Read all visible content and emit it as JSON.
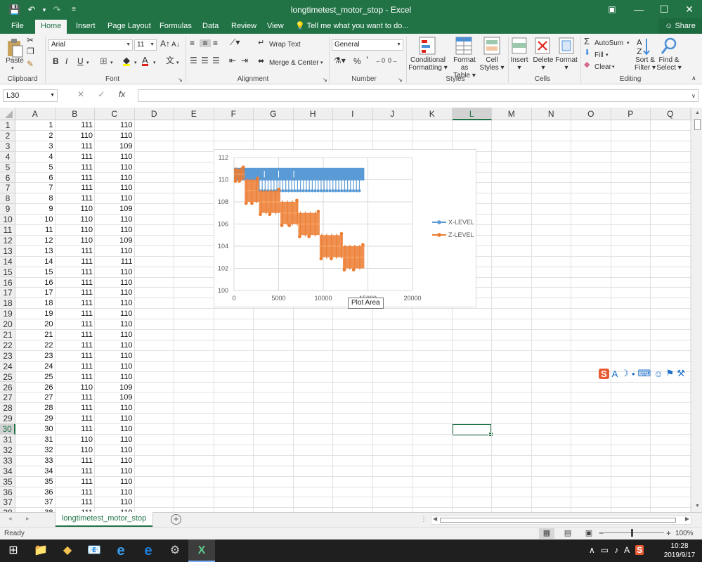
{
  "window": {
    "title": "longtimetest_motor_stop - Excel",
    "minimize": "—",
    "maximize": "☐",
    "close": "✕",
    "ribbon_options": "▣"
  },
  "qat": {
    "save": "💾",
    "undo": "↶",
    "undo_dd": "▾",
    "redo": "↷",
    "customize": "≡"
  },
  "tabs": [
    "File",
    "Home",
    "Insert",
    "Page Layout",
    "Formulas",
    "Data",
    "Review",
    "View"
  ],
  "active_tab": "Home",
  "tell_me": "Tell me what you want to do...",
  "share": "Share",
  "ribbon": {
    "clipboard": {
      "label": "Clipboard",
      "paste": "Paste"
    },
    "font": {
      "label": "Font",
      "name": "Arial",
      "size": "11",
      "bold": "B",
      "italic": "I",
      "underline": "U"
    },
    "alignment": {
      "label": "Alignment",
      "wrap": "Wrap Text",
      "merge": "Merge & Center"
    },
    "number": {
      "label": "Number",
      "format": "General",
      "percent": "%",
      "comma": "’"
    },
    "styles": {
      "label": "Styles",
      "conditional": [
        "Conditional",
        "Formatting ▾"
      ],
      "format_table": [
        "Format as",
        "Table ▾"
      ],
      "cell_styles": [
        "Cell",
        "Styles ▾"
      ]
    },
    "cells": {
      "label": "Cells",
      "insert": "Insert",
      "delete": "Delete",
      "format": "Format"
    },
    "editing": {
      "label": "Editing",
      "autosum": "AutoSum",
      "fill": "Fill",
      "clear": "Clear",
      "sort": [
        "Sort &",
        "Filter ▾"
      ],
      "find": [
        "Find &",
        "Select ▾"
      ]
    }
  },
  "formula_bar": {
    "namebox": "L30",
    "cancel": "✕",
    "enter": "✓",
    "fx": "fx",
    "value": ""
  },
  "columns": [
    "A",
    "B",
    "C",
    "D",
    "E",
    "F",
    "G",
    "H",
    "I",
    "J",
    "K",
    "L",
    "M",
    "N",
    "O",
    "P",
    "Q"
  ],
  "selected_column": "L",
  "selected_row": 30,
  "rows": [
    [
      1,
      111,
      110
    ],
    [
      2,
      110,
      110
    ],
    [
      3,
      111,
      109
    ],
    [
      4,
      111,
      110
    ],
    [
      5,
      111,
      110
    ],
    [
      6,
      111,
      110
    ],
    [
      7,
      111,
      110
    ],
    [
      8,
      111,
      110
    ],
    [
      9,
      110,
      109
    ],
    [
      10,
      110,
      110
    ],
    [
      11,
      110,
      110
    ],
    [
      12,
      110,
      109
    ],
    [
      13,
      111,
      110
    ],
    [
      14,
      111,
      111
    ],
    [
      15,
      111,
      110
    ],
    [
      16,
      111,
      110
    ],
    [
      17,
      111,
      110
    ],
    [
      18,
      111,
      110
    ],
    [
      19,
      111,
      110
    ],
    [
      20,
      111,
      110
    ],
    [
      21,
      111,
      110
    ],
    [
      22,
      111,
      110
    ],
    [
      23,
      111,
      110
    ],
    [
      24,
      111,
      110
    ],
    [
      25,
      111,
      110
    ],
    [
      26,
      110,
      109
    ],
    [
      27,
      111,
      109
    ],
    [
      28,
      111,
      110
    ],
    [
      29,
      111,
      110
    ],
    [
      30,
      111,
      110
    ],
    [
      31,
      110,
      110
    ],
    [
      32,
      110,
      110
    ],
    [
      33,
      111,
      110
    ],
    [
      34,
      111,
      110
    ],
    [
      35,
      111,
      110
    ],
    [
      36,
      111,
      110
    ],
    [
      37,
      111,
      110
    ],
    [
      38,
      111,
      110
    ]
  ],
  "chart_data": {
    "type": "line",
    "xlim": [
      0,
      20000
    ],
    "ylim": [
      100,
      112
    ],
    "x_ticks": [
      "0",
      "5000",
      "10000",
      "15000",
      "20000"
    ],
    "y_ticks": [
      "100",
      "102",
      "104",
      "106",
      "108",
      "110",
      "112"
    ],
    "grid": true,
    "legend_position": "right",
    "series": [
      {
        "name": "X-LEVEL",
        "color": "#5b9bd5",
        "x": [
          0,
          14600
        ],
        "y_high": 111,
        "y_low": 110,
        "y_dip": 109,
        "dip_start": 2500,
        "dip_end": 14200,
        "dip_step": 330
      },
      {
        "name": "Z-LEVEL",
        "color": "#ed7d31",
        "steps": [
          {
            "x0": 0,
            "x1": 1200,
            "top": 111,
            "bottom": 110
          },
          {
            "x0": 1200,
            "x1": 2800,
            "top": 110,
            "bottom": 108
          },
          {
            "x0": 2800,
            "x1": 5200,
            "top": 109,
            "bottom": 107
          },
          {
            "x0": 5200,
            "x1": 7200,
            "top": 108,
            "bottom": 106
          },
          {
            "x0": 7200,
            "x1": 9600,
            "top": 107,
            "bottom": 105
          },
          {
            "x0": 9600,
            "x1": 12200,
            "top": 105,
            "bottom": 103
          },
          {
            "x0": 12200,
            "x1": 14600,
            "top": 104,
            "bottom": 102
          }
        ]
      }
    ]
  },
  "tooltip": "Plot Area",
  "sheet": {
    "name": "longtimetest_motor_stop",
    "add": "+",
    "nav": [
      "◂",
      "▸"
    ],
    "dots": "⋮"
  },
  "status": {
    "text": "Ready",
    "zoom": "100%",
    "minus": "−",
    "plus": "+"
  },
  "taskbar": {
    "apps": [
      "⊞",
      "📁",
      "◆",
      "📧",
      "e",
      "e",
      "⚙",
      "X"
    ],
    "tray": [
      "∧",
      "▭",
      "♪",
      "A",
      "S"
    ],
    "time": "10:28",
    "date": "2019/9/17"
  },
  "ime": [
    "S",
    "A",
    "☽",
    "•",
    "⌨",
    "☺",
    "⚑",
    "⚒"
  ]
}
